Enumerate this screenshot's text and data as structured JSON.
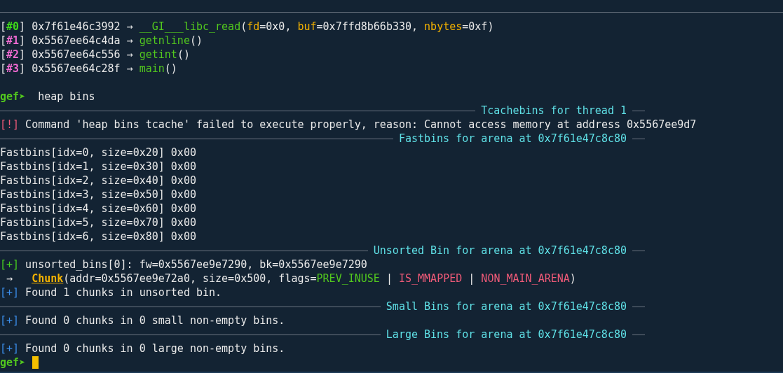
{
  "lines": [
    {
      "kind": "rule"
    },
    {
      "kind": "text",
      "segments": [
        {
          "text": "[",
          "kind": "plain"
        },
        {
          "text": "#0",
          "kind": "current"
        },
        {
          "text": "] 0x7f61e46c3992 → ",
          "kind": "plain"
        },
        {
          "text": "__GI___libc_read",
          "kind": "func"
        },
        {
          "text": "(",
          "kind": "plain"
        },
        {
          "text": "fd",
          "kind": "arg"
        },
        {
          "text": "=0x0, ",
          "kind": "plain"
        },
        {
          "text": "buf",
          "kind": "arg"
        },
        {
          "text": "=0x7ffd8b66b330, ",
          "kind": "plain"
        },
        {
          "text": "nbytes",
          "kind": "arg"
        },
        {
          "text": "=0xf)",
          "kind": "plain"
        }
      ]
    },
    {
      "kind": "text",
      "segments": [
        {
          "text": "[",
          "kind": "plain"
        },
        {
          "text": "#1",
          "kind": "frame"
        },
        {
          "text": "] 0x5567ee64c4da → ",
          "kind": "plain"
        },
        {
          "text": "getnline",
          "kind": "func"
        },
        {
          "text": "()",
          "kind": "plain"
        }
      ]
    },
    {
      "kind": "text",
      "segments": [
        {
          "text": "[",
          "kind": "plain"
        },
        {
          "text": "#2",
          "kind": "frame"
        },
        {
          "text": "] 0x5567ee64c556 → ",
          "kind": "plain"
        },
        {
          "text": "getint",
          "kind": "func"
        },
        {
          "text": "()",
          "kind": "plain"
        }
      ]
    },
    {
      "kind": "text",
      "segments": [
        {
          "text": "[",
          "kind": "plain"
        },
        {
          "text": "#3",
          "kind": "frame"
        },
        {
          "text": "] 0x5567ee64c28f → ",
          "kind": "plain"
        },
        {
          "text": "main",
          "kind": "func"
        },
        {
          "text": "()",
          "kind": "plain"
        }
      ]
    },
    {
      "kind": "blank"
    },
    {
      "kind": "text",
      "segments": [
        {
          "text": "gef➤",
          "kind": "prompt"
        },
        {
          "text": "  heap bins",
          "kind": "plain"
        }
      ]
    },
    {
      "kind": "header",
      "title": "Tcachebins for thread 1"
    },
    {
      "kind": "text",
      "segments": [
        {
          "text": "[!]",
          "kind": "error"
        },
        {
          "text": " Command 'heap bins tcache' failed to execute properly, reason: Cannot access memory at address 0x5567ee9d7",
          "kind": "plain"
        }
      ]
    },
    {
      "kind": "header",
      "title": "Fastbins for arena at 0x7f61e47c8c80"
    },
    {
      "kind": "text",
      "segments": [
        {
          "text": "Fastbins[idx=0, size=0x20] 0x00",
          "kind": "plain"
        }
      ]
    },
    {
      "kind": "text",
      "segments": [
        {
          "text": "Fastbins[idx=1, size=0x30] 0x00",
          "kind": "plain"
        }
      ]
    },
    {
      "kind": "text",
      "segments": [
        {
          "text": "Fastbins[idx=2, size=0x40] 0x00",
          "kind": "plain"
        }
      ]
    },
    {
      "kind": "text",
      "segments": [
        {
          "text": "Fastbins[idx=3, size=0x50] 0x00",
          "kind": "plain"
        }
      ]
    },
    {
      "kind": "text",
      "segments": [
        {
          "text": "Fastbins[idx=4, size=0x60] 0x00",
          "kind": "plain"
        }
      ]
    },
    {
      "kind": "text",
      "segments": [
        {
          "text": "Fastbins[idx=5, size=0x70] 0x00",
          "kind": "plain"
        }
      ]
    },
    {
      "kind": "text",
      "segments": [
        {
          "text": "Fastbins[idx=6, size=0x80] 0x00",
          "kind": "plain"
        }
      ]
    },
    {
      "kind": "header",
      "title": "Unsorted Bin for arena at 0x7f61e47c8c80"
    },
    {
      "kind": "text",
      "segments": [
        {
          "text": "[+]",
          "kind": "ok"
        },
        {
          "text": " unsorted_bins[0]: fw=0x5567ee9e7290, bk=0x5567ee9e7290",
          "kind": "plain"
        }
      ]
    },
    {
      "kind": "text",
      "segments": [
        {
          "text": " →   ",
          "kind": "plain"
        },
        {
          "text": "Chunk",
          "kind": "chunk"
        },
        {
          "text": "(addr=0x5567ee9e72a0, size=0x500, flags=",
          "kind": "plain"
        },
        {
          "text": "PREV_INUSE",
          "kind": "flagon"
        },
        {
          "text": " | ",
          "kind": "plain"
        },
        {
          "text": "IS_MMAPPED",
          "kind": "flagoff"
        },
        {
          "text": " | ",
          "kind": "plain"
        },
        {
          "text": "NON_MAIN_ARENA",
          "kind": "flagoff"
        },
        {
          "text": ")",
          "kind": "plain"
        }
      ]
    },
    {
      "kind": "text",
      "segments": [
        {
          "text": "[+]",
          "kind": "info"
        },
        {
          "text": " Found 1 chunks in unsorted bin.",
          "kind": "plain"
        }
      ]
    },
    {
      "kind": "header",
      "title": "Small Bins for arena at 0x7f61e47c8c80"
    },
    {
      "kind": "text",
      "segments": [
        {
          "text": "[+]",
          "kind": "info"
        },
        {
          "text": " Found 0 chunks in 0 small non-empty bins.",
          "kind": "plain"
        }
      ]
    },
    {
      "kind": "header",
      "title": "Large Bins for arena at 0x7f61e47c8c80"
    },
    {
      "kind": "text",
      "segments": [
        {
          "text": "[+]",
          "kind": "info"
        },
        {
          "text": " Found 0 chunks in 0 large non-empty bins.",
          "kind": "plain"
        }
      ]
    },
    {
      "kind": "text",
      "cursor": true,
      "segments": [
        {
          "text": "gef➤",
          "kind": "prompt"
        }
      ]
    }
  ]
}
